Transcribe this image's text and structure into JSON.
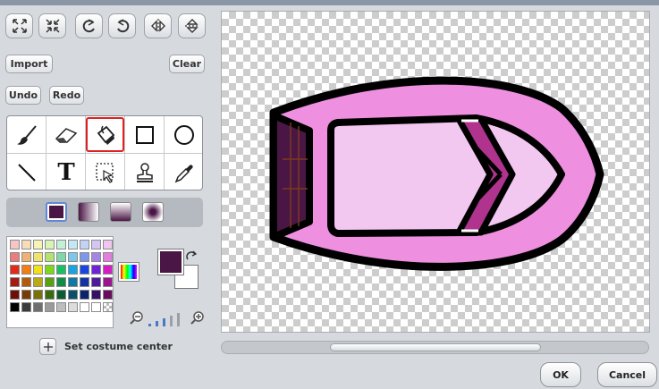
{
  "toolbar": {
    "import_label": "Import",
    "clear_label": "Clear",
    "undo_label": "Undo",
    "redo_label": "Redo",
    "transform_icons": [
      "grow-icon",
      "shrink-icon",
      "rotate-left-icon",
      "rotate-right-icon",
      "flip-horizontal-icon",
      "flip-vertical-icon"
    ]
  },
  "tools": {
    "items": [
      "paintbrush",
      "eraser",
      "fill-bucket",
      "rectangle",
      "ellipse",
      "line",
      "text",
      "select",
      "stamp",
      "eyedropper"
    ],
    "selected": "fill-bucket",
    "text_tool_glyph": "T"
  },
  "fill_styles": [
    "solid",
    "horizontal-gradient",
    "vertical-gradient",
    "radial-gradient"
  ],
  "colors": {
    "foreground": "#4a1646",
    "background": "#ffffff",
    "selected_tool_border": "#e02020",
    "boat_outer": "#ee8fe0",
    "boat_inner": "#f3c8f0",
    "boat_stripe": "#b0338e",
    "boat_back": "#4a1646",
    "palette": [
      [
        "#f4c6c6",
        "#f6dcb8",
        "#f6f3b6",
        "#d7f3b6",
        "#c4f0d8",
        "#c4e7f3",
        "#c4d3f5",
        "#d3c6f2",
        "#f0c6ef"
      ],
      [
        "#ea7d7d",
        "#eeb273",
        "#eee46d",
        "#b2e26f",
        "#7ed8ab",
        "#7dc7e8",
        "#7d97ea",
        "#a485e6",
        "#e37dde"
      ],
      [
        "#e22a1c",
        "#f07e12",
        "#f2e01b",
        "#7dd81b",
        "#1bbf62",
        "#1aa3df",
        "#1a45df",
        "#6e24d6",
        "#d51dc4"
      ],
      [
        "#a51b11",
        "#b05c0c",
        "#b9ab11",
        "#58a012",
        "#128b47",
        "#1277a3",
        "#1234a3",
        "#501a9c",
        "#9c148e"
      ],
      [
        "#6e0f09",
        "#753d07",
        "#7a7109",
        "#396a0b",
        "#0b5c2f",
        "#0b4f6d",
        "#0b226d",
        "#350f68",
        "#680d5e"
      ],
      [
        "#000000",
        "#3b3b3b",
        "#6e6e6e",
        "#9a9a9a",
        "#bdbdbd",
        "#dcdcdc",
        "#ffffff",
        "#ffffff",
        "transparent"
      ]
    ]
  },
  "zoom": {
    "level": 3,
    "max": 5,
    "zoom_out_icon": "zoom-out-icon",
    "zoom_in_icon": "zoom-in-icon"
  },
  "costume_center_label": "Set costume center",
  "dialog": {
    "ok_label": "OK",
    "cancel_label": "Cancel"
  }
}
